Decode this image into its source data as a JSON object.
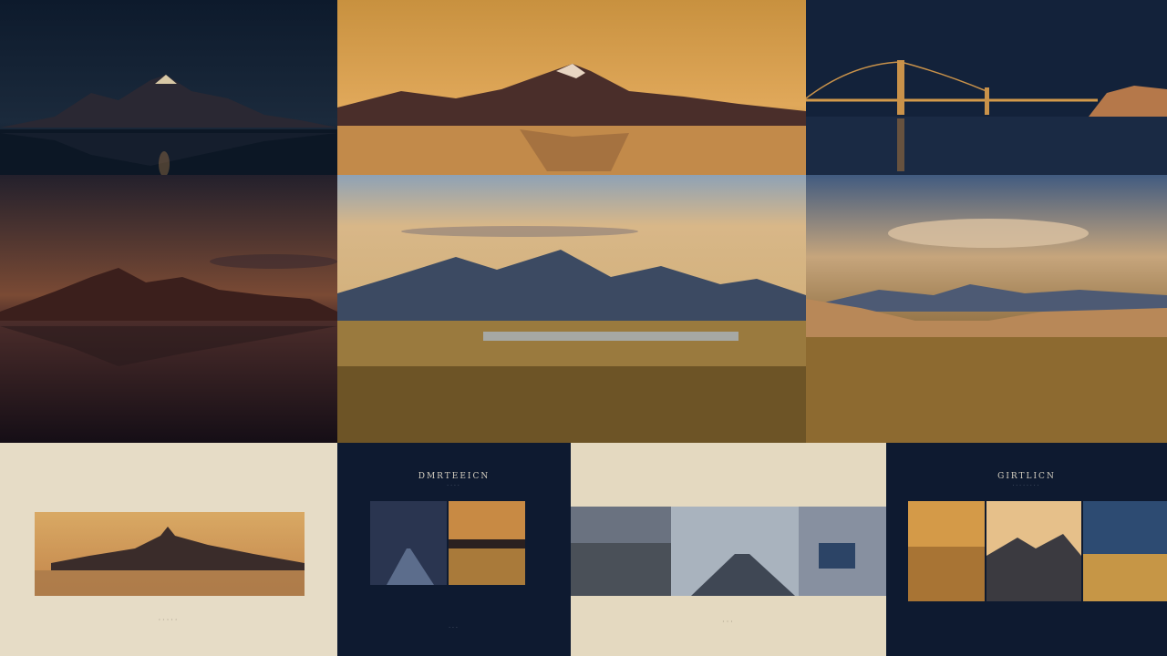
{
  "mosaic": {
    "tiles": [
      {
        "subject": "mountain range at dusk over calm lake",
        "palette": "#0f1b2e"
      },
      {
        "subject": "snow peak at golden hour over lake",
        "palette": "#c98a3c"
      },
      {
        "subject": "suspension bridge over water at twilight",
        "palette": "#132038"
      },
      {
        "subject": "mountain silhouette reflected in lake at sunset",
        "palette": "#3a2430"
      },
      {
        "subject": "mountain range with lake and golden grassland",
        "palette": "#b7a27a"
      },
      {
        "subject": "desert dunes and distant mountains under evening clouds",
        "palette": "#6f86a3"
      }
    ],
    "panels": [
      {
        "kind": "light-card",
        "caption": "·····"
      },
      {
        "kind": "dark-card",
        "title": "DMRTEEICN",
        "subtitle": "····",
        "footer": "···"
      },
      {
        "kind": "light-strip",
        "caption": "···"
      },
      {
        "kind": "dark-card",
        "title": "GIRTLICN",
        "subtitle": "········"
      }
    ]
  },
  "colors": {
    "navy": "#0e1a30",
    "cream": "#e6dcc6",
    "gold": "#d89a45"
  }
}
